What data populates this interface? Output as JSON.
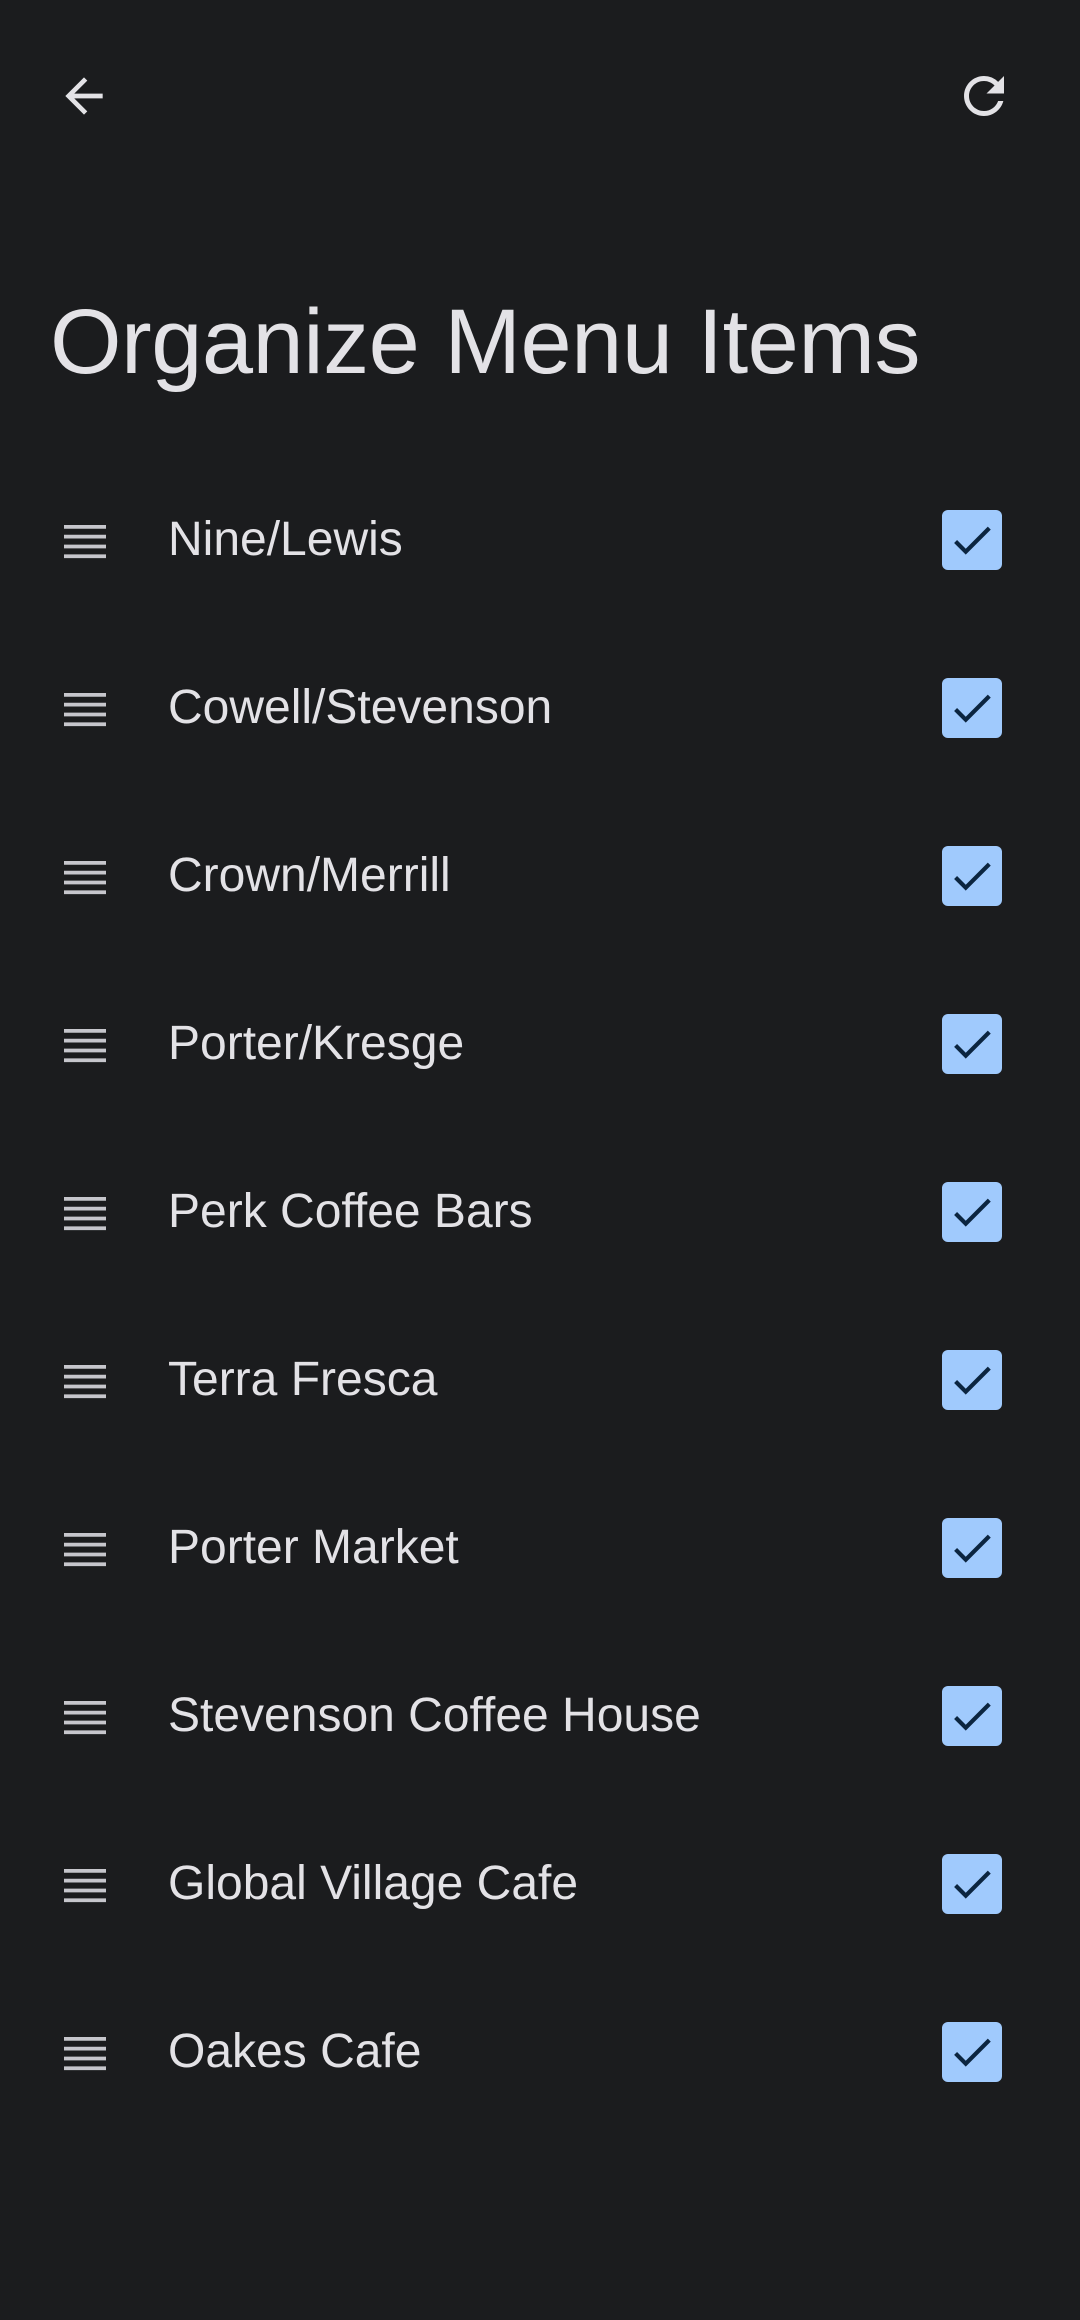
{
  "header": {
    "back_icon": "arrow-left-icon",
    "refresh_icon": "refresh-icon"
  },
  "page": {
    "title": "Organize Menu Items"
  },
  "colors": {
    "background": "#1b1c1e",
    "text": "#e3e2e6",
    "checkbox_fill": "#a0cafd",
    "checkmark": "#0b2540"
  },
  "menu_items": [
    {
      "label": "Nine/Lewis",
      "checked": true
    },
    {
      "label": "Cowell/Stevenson",
      "checked": true
    },
    {
      "label": "Crown/Merrill",
      "checked": true
    },
    {
      "label": "Porter/Kresge",
      "checked": true
    },
    {
      "label": "Perk Coffee Bars",
      "checked": true
    },
    {
      "label": "Terra Fresca",
      "checked": true
    },
    {
      "label": "Porter Market",
      "checked": true
    },
    {
      "label": "Stevenson Coffee House",
      "checked": true
    },
    {
      "label": "Global Village Cafe",
      "checked": true
    },
    {
      "label": "Oakes Cafe",
      "checked": true
    }
  ]
}
